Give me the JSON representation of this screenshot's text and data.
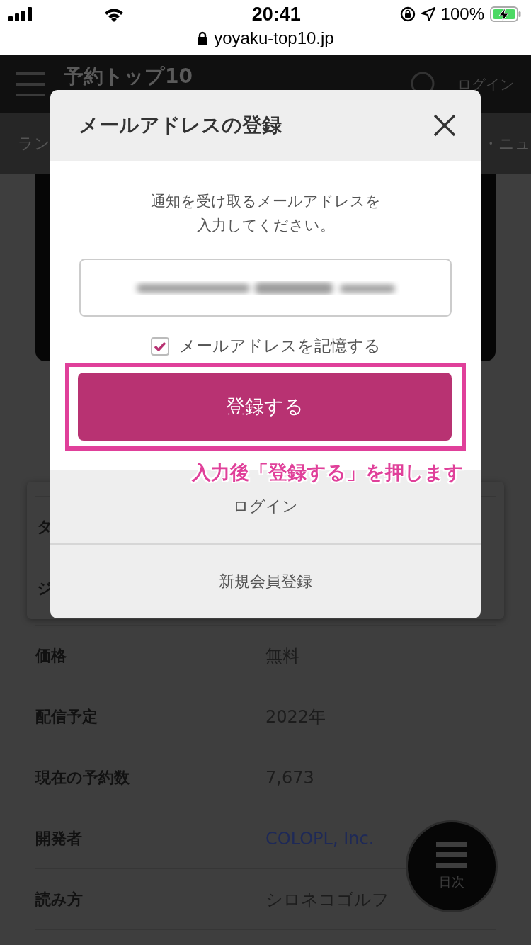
{
  "status_bar": {
    "time": "20:41",
    "battery": "100%",
    "charging": true
  },
  "browser": {
    "url": "yoyaku-top10.jp"
  },
  "site_header": {
    "logo": "予約トップ10",
    "login": "ログイン"
  },
  "nav": {
    "items": [
      "ラン",
      "・ニュ"
    ]
  },
  "page": {
    "info_rows": [
      {
        "label": "タ"
      },
      {
        "label": "ジ"
      }
    ],
    "details": [
      {
        "label": "価格",
        "value": "無料",
        "kind": "text"
      },
      {
        "label": "配信予定",
        "value": "2022年",
        "kind": "text"
      },
      {
        "label": "現在の予約数",
        "value": "7,673",
        "kind": "text"
      },
      {
        "label": "開発者",
        "value": "COLOPL, Inc.",
        "kind": "link"
      },
      {
        "label": "読み方",
        "value": "シロネコゴルフ",
        "kind": "text"
      }
    ]
  },
  "toc_button": {
    "label": "目次"
  },
  "modal": {
    "title": "メールアドレスの登録",
    "message": [
      "通知を受け取るメールアドレスを",
      "入力してください。"
    ],
    "remember": {
      "label": "メールアドレスを記憶する",
      "checked": true
    },
    "submit": "登録する",
    "annotation": "入力後「登録する」を押します",
    "links": [
      "ログイン",
      "新規会員登録"
    ]
  }
}
